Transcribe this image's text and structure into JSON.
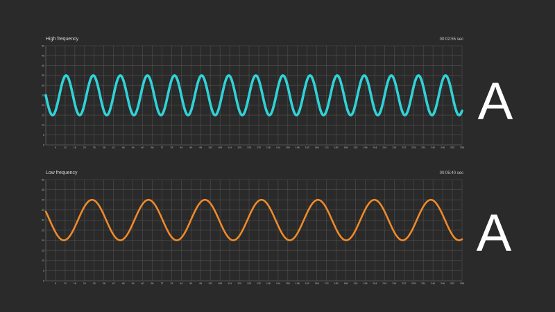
{
  "chart_data": [
    {
      "type": "line",
      "title": "High frequency",
      "time_readout": "00:02:55 sec",
      "side_label": "A",
      "color": "#2fd3d8",
      "xlim": [
        0,
        258
      ],
      "x_ticks": [
        6,
        12,
        18,
        24,
        30,
        36,
        42,
        48,
        54,
        60,
        66,
        72,
        78,
        84,
        90,
        96,
        102,
        108,
        114,
        120,
        126,
        132,
        138,
        144,
        150,
        156,
        162,
        168,
        174,
        180,
        186,
        192,
        198,
        204,
        210,
        216,
        222,
        228,
        234,
        240,
        246,
        252,
        258
      ],
      "ylim": [
        0,
        50
      ],
      "y_ticks": [
        0,
        5,
        10,
        15,
        20,
        25,
        30,
        35,
        40,
        45,
        50
      ],
      "series": [
        {
          "amplitude": 10,
          "offset": 25,
          "period": 16.8,
          "phase_deg": 180,
          "stroke_width": 3.6
        }
      ]
    },
    {
      "type": "line",
      "title": "Low frequency",
      "time_readout": "00:05:40 sec",
      "side_label": "A",
      "color": "#f08a2a",
      "xlim": [
        0,
        258
      ],
      "x_ticks": [
        6,
        12,
        18,
        24,
        30,
        36,
        42,
        48,
        54,
        60,
        66,
        72,
        78,
        84,
        90,
        96,
        102,
        108,
        114,
        120,
        126,
        132,
        138,
        144,
        150,
        156,
        162,
        168,
        174,
        180,
        186,
        192,
        198,
        204,
        210,
        216,
        222,
        228,
        234,
        240,
        246,
        252,
        258
      ],
      "ylim": [
        0,
        50
      ],
      "y_ticks": [
        0,
        5,
        10,
        15,
        20,
        25,
        30,
        35,
        40,
        45,
        50
      ],
      "series": [
        {
          "amplitude": 10,
          "offset": 30,
          "period": 35,
          "phase_deg": 155,
          "stroke_width": 2.6
        }
      ]
    }
  ]
}
